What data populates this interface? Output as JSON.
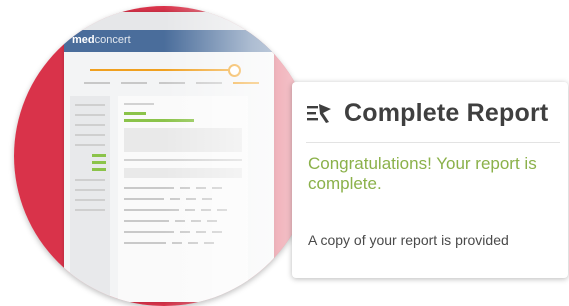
{
  "browser": {
    "nav_glyphs": "◀ ▶",
    "logo_bold": "med",
    "logo_light": "concert",
    "progress_fraction": 0.96
  },
  "card": {
    "title": "Complete Report",
    "icon": "report-flag-icon",
    "message": "Congratulations! Your report is complete.",
    "note": "A copy of your report is provided"
  },
  "colors": {
    "accent_red": "#d9334a",
    "brand_blue": "#4a6d9b",
    "progress_orange": "#f0a020",
    "success_green": "#8bb14a",
    "title_gray": "#3f3f3f"
  }
}
